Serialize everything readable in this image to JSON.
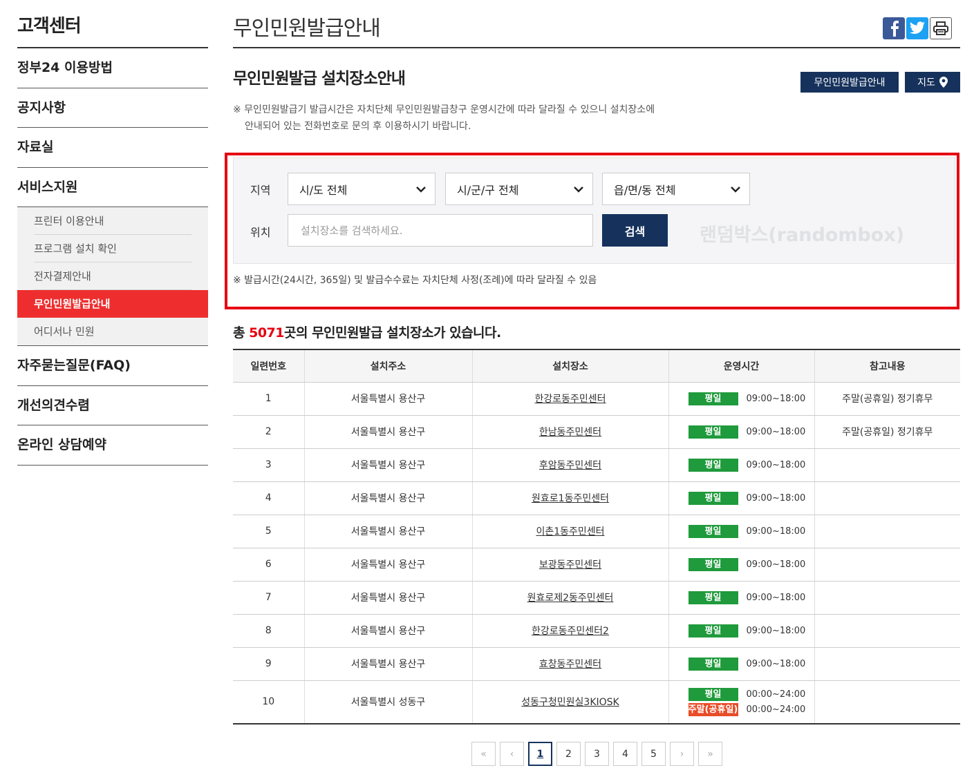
{
  "sidebar": {
    "title": "고객센터",
    "items": [
      {
        "label": "정부24 이용방법"
      },
      {
        "label": "공지사항"
      },
      {
        "label": "자료실"
      },
      {
        "label": "서비스지원"
      }
    ],
    "sub_items": [
      {
        "label": "프린터 이용안내"
      },
      {
        "label": "프로그램 설치 확인"
      },
      {
        "label": "전자결제안내"
      },
      {
        "label": "무인민원발급안내"
      },
      {
        "label": "어디서나 민원"
      }
    ],
    "items_after": [
      {
        "label": "자주묻는질문(FAQ)"
      },
      {
        "label": "개선의견수렴"
      },
      {
        "label": "온라인 상담예약"
      }
    ]
  },
  "header": {
    "title": "무인민원발급안내"
  },
  "section": {
    "title": "무인민원발급 설치장소안내",
    "btn_guide": "무인민원발급안내",
    "btn_map": "지도",
    "notice_line1": "※ 무인민원발급기 발급시간은 자치단체 무인민원발급창구 운영시간에 따라 달라질 수 있으니 설치장소에",
    "notice_line2": "안내되어 있는 전화번호로 문의 후 이용하시기 바랍니다."
  },
  "search": {
    "region_label": "지역",
    "location_label": "위치",
    "sido": "시/도 전체",
    "sigungu": "시/군/구 전체",
    "eupmyeondong": "읍/면/동 전체",
    "placeholder": "설치장소를 검색하세요.",
    "button": "검색",
    "watermark": "랜덤박스(randombox)",
    "note": "※ 발급시간(24시간, 365일) 및 발급수수료는 자치단체 사정(조례)에 따라 달라질 수 있음"
  },
  "count": {
    "prefix": "총 ",
    "number": "5071",
    "suffix": "곳의 무인민원발급 설치장소가 있습니다."
  },
  "table": {
    "headers": [
      "일련번호",
      "설치주소",
      "설치장소",
      "운영시간",
      "참고내용"
    ],
    "rows": [
      {
        "no": "1",
        "address": "서울특별시 용산구",
        "place": "한강로동주민센터",
        "hours": [
          {
            "badge": "평일",
            "time": "09:00~18:00",
            "color": "green"
          }
        ],
        "note": "주말(공휴일) 정기휴무"
      },
      {
        "no": "2",
        "address": "서울특별시 용산구",
        "place": "한남동주민센터",
        "hours": [
          {
            "badge": "평일",
            "time": "09:00~18:00",
            "color": "green"
          }
        ],
        "note": "주말(공휴일) 정기휴무"
      },
      {
        "no": "3",
        "address": "서울특별시 용산구",
        "place": "후암동주민센터",
        "hours": [
          {
            "badge": "평일",
            "time": "09:00~18:00",
            "color": "green"
          }
        ],
        "note": ""
      },
      {
        "no": "4",
        "address": "서울특별시 용산구",
        "place": "원효로1동주민센터",
        "hours": [
          {
            "badge": "평일",
            "time": "09:00~18:00",
            "color": "green"
          }
        ],
        "note": ""
      },
      {
        "no": "5",
        "address": "서울특별시 용산구",
        "place": "이촌1동주민센터",
        "hours": [
          {
            "badge": "평일",
            "time": "09:00~18:00",
            "color": "green"
          }
        ],
        "note": ""
      },
      {
        "no": "6",
        "address": "서울특별시 용산구",
        "place": "보광동주민센터",
        "hours": [
          {
            "badge": "평일",
            "time": "09:00~18:00",
            "color": "green"
          }
        ],
        "note": ""
      },
      {
        "no": "7",
        "address": "서울특별시 용산구",
        "place": "원효로제2동주민센터",
        "hours": [
          {
            "badge": "평일",
            "time": "09:00~18:00",
            "color": "green"
          }
        ],
        "note": ""
      },
      {
        "no": "8",
        "address": "서울특별시 용산구",
        "place": "한강로동주민센터2",
        "hours": [
          {
            "badge": "평일",
            "time": "09:00~18:00",
            "color": "green"
          }
        ],
        "note": ""
      },
      {
        "no": "9",
        "address": "서울특별시 용산구",
        "place": "효창동주민센터",
        "hours": [
          {
            "badge": "평일",
            "time": "09:00~18:00",
            "color": "green"
          }
        ],
        "note": ""
      },
      {
        "no": "10",
        "address": "서울특별시 성동구",
        "place": "성동구청민원실3KIOSK",
        "hours": [
          {
            "badge": "평일",
            "time": "00:00~24:00",
            "color": "green"
          },
          {
            "badge": "주말(공휴일)",
            "time": "00:00~24:00",
            "color": "red"
          }
        ],
        "note": ""
      }
    ]
  },
  "pagination": {
    "first": "«",
    "prev": "‹",
    "pages": [
      "1",
      "2",
      "3",
      "4",
      "5"
    ],
    "current": "1",
    "next": "›",
    "last": "»"
  },
  "colors": {
    "accent_red": "#ee2e2e",
    "navy": "#16325c",
    "badge_green": "#1f9a3c",
    "badge_red": "#e84c28",
    "highlight_border": "#e60012"
  }
}
